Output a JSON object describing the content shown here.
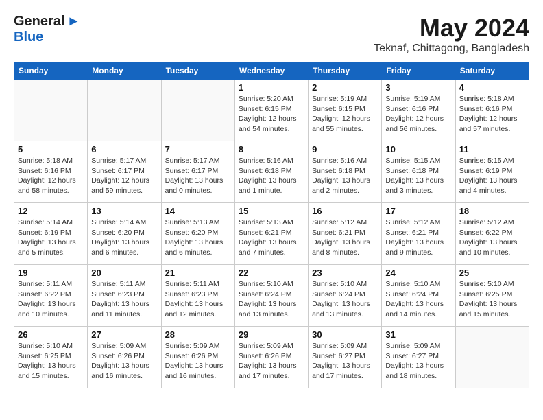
{
  "header": {
    "logo_general": "General",
    "logo_blue": "Blue",
    "month_title": "May 2024",
    "location": "Teknaf, Chittagong, Bangladesh"
  },
  "calendar": {
    "days_of_week": [
      "Sunday",
      "Monday",
      "Tuesday",
      "Wednesday",
      "Thursday",
      "Friday",
      "Saturday"
    ],
    "weeks": [
      [
        {
          "day": "",
          "info": ""
        },
        {
          "day": "",
          "info": ""
        },
        {
          "day": "",
          "info": ""
        },
        {
          "day": "1",
          "info": "Sunrise: 5:20 AM\nSunset: 6:15 PM\nDaylight: 12 hours\nand 54 minutes."
        },
        {
          "day": "2",
          "info": "Sunrise: 5:19 AM\nSunset: 6:15 PM\nDaylight: 12 hours\nand 55 minutes."
        },
        {
          "day": "3",
          "info": "Sunrise: 5:19 AM\nSunset: 6:16 PM\nDaylight: 12 hours\nand 56 minutes."
        },
        {
          "day": "4",
          "info": "Sunrise: 5:18 AM\nSunset: 6:16 PM\nDaylight: 12 hours\nand 57 minutes."
        }
      ],
      [
        {
          "day": "5",
          "info": "Sunrise: 5:18 AM\nSunset: 6:16 PM\nDaylight: 12 hours\nand 58 minutes."
        },
        {
          "day": "6",
          "info": "Sunrise: 5:17 AM\nSunset: 6:17 PM\nDaylight: 12 hours\nand 59 minutes."
        },
        {
          "day": "7",
          "info": "Sunrise: 5:17 AM\nSunset: 6:17 PM\nDaylight: 13 hours\nand 0 minutes."
        },
        {
          "day": "8",
          "info": "Sunrise: 5:16 AM\nSunset: 6:18 PM\nDaylight: 13 hours\nand 1 minute."
        },
        {
          "day": "9",
          "info": "Sunrise: 5:16 AM\nSunset: 6:18 PM\nDaylight: 13 hours\nand 2 minutes."
        },
        {
          "day": "10",
          "info": "Sunrise: 5:15 AM\nSunset: 6:18 PM\nDaylight: 13 hours\nand 3 minutes."
        },
        {
          "day": "11",
          "info": "Sunrise: 5:15 AM\nSunset: 6:19 PM\nDaylight: 13 hours\nand 4 minutes."
        }
      ],
      [
        {
          "day": "12",
          "info": "Sunrise: 5:14 AM\nSunset: 6:19 PM\nDaylight: 13 hours\nand 5 minutes."
        },
        {
          "day": "13",
          "info": "Sunrise: 5:14 AM\nSunset: 6:20 PM\nDaylight: 13 hours\nand 6 minutes."
        },
        {
          "day": "14",
          "info": "Sunrise: 5:13 AM\nSunset: 6:20 PM\nDaylight: 13 hours\nand 6 minutes."
        },
        {
          "day": "15",
          "info": "Sunrise: 5:13 AM\nSunset: 6:21 PM\nDaylight: 13 hours\nand 7 minutes."
        },
        {
          "day": "16",
          "info": "Sunrise: 5:12 AM\nSunset: 6:21 PM\nDaylight: 13 hours\nand 8 minutes."
        },
        {
          "day": "17",
          "info": "Sunrise: 5:12 AM\nSunset: 6:21 PM\nDaylight: 13 hours\nand 9 minutes."
        },
        {
          "day": "18",
          "info": "Sunrise: 5:12 AM\nSunset: 6:22 PM\nDaylight: 13 hours\nand 10 minutes."
        }
      ],
      [
        {
          "day": "19",
          "info": "Sunrise: 5:11 AM\nSunset: 6:22 PM\nDaylight: 13 hours\nand 10 minutes."
        },
        {
          "day": "20",
          "info": "Sunrise: 5:11 AM\nSunset: 6:23 PM\nDaylight: 13 hours\nand 11 minutes."
        },
        {
          "day": "21",
          "info": "Sunrise: 5:11 AM\nSunset: 6:23 PM\nDaylight: 13 hours\nand 12 minutes."
        },
        {
          "day": "22",
          "info": "Sunrise: 5:10 AM\nSunset: 6:24 PM\nDaylight: 13 hours\nand 13 minutes."
        },
        {
          "day": "23",
          "info": "Sunrise: 5:10 AM\nSunset: 6:24 PM\nDaylight: 13 hours\nand 13 minutes."
        },
        {
          "day": "24",
          "info": "Sunrise: 5:10 AM\nSunset: 6:24 PM\nDaylight: 13 hours\nand 14 minutes."
        },
        {
          "day": "25",
          "info": "Sunrise: 5:10 AM\nSunset: 6:25 PM\nDaylight: 13 hours\nand 15 minutes."
        }
      ],
      [
        {
          "day": "26",
          "info": "Sunrise: 5:10 AM\nSunset: 6:25 PM\nDaylight: 13 hours\nand 15 minutes."
        },
        {
          "day": "27",
          "info": "Sunrise: 5:09 AM\nSunset: 6:26 PM\nDaylight: 13 hours\nand 16 minutes."
        },
        {
          "day": "28",
          "info": "Sunrise: 5:09 AM\nSunset: 6:26 PM\nDaylight: 13 hours\nand 16 minutes."
        },
        {
          "day": "29",
          "info": "Sunrise: 5:09 AM\nSunset: 6:26 PM\nDaylight: 13 hours\nand 17 minutes."
        },
        {
          "day": "30",
          "info": "Sunrise: 5:09 AM\nSunset: 6:27 PM\nDaylight: 13 hours\nand 17 minutes."
        },
        {
          "day": "31",
          "info": "Sunrise: 5:09 AM\nSunset: 6:27 PM\nDaylight: 13 hours\nand 18 minutes."
        },
        {
          "day": "",
          "info": ""
        }
      ]
    ]
  }
}
